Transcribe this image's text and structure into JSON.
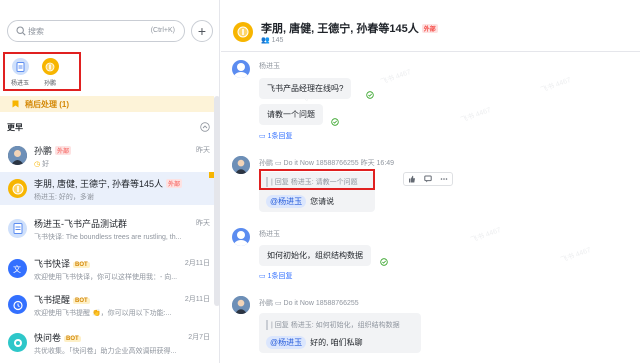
{
  "search": {
    "placeholder": "搜索",
    "shortcut": "(Ctrl+K)",
    "add_label": "+"
  },
  "pinned": [
    {
      "label": "杨进玉"
    },
    {
      "label": "孙鹏"
    }
  ],
  "later": {
    "label": "稍后处理 (1)"
  },
  "section": {
    "title": "更早"
  },
  "conversations": [
    {
      "name": "孙鹏",
      "tag": "外部",
      "preview": "好",
      "time": "昨天"
    },
    {
      "name": "李朋, 唐健, 王德宁, 孙春等145人",
      "tag": "外部",
      "preview": "杨进玉: 好的，多谢",
      "time": ""
    },
    {
      "name": "杨进玉-飞书产品测试群",
      "tag": "",
      "preview": "飞书快译: The boundless trees are rustling, th...",
      "time": "昨天"
    },
    {
      "name": "飞书快译",
      "tag": "BOT",
      "preview": "欢迎使用飞书快译，你可以这样使用我：- 向...",
      "time": "2月11日"
    },
    {
      "name": "飞书提醒",
      "tag": "BOT",
      "preview": "欢迎使用飞书提醒 👏，你可以用以下功能:...",
      "time": "2月11日"
    },
    {
      "name": "快问卷",
      "tag": "BOT",
      "preview": "共优收集。「快问卷」助力企业高效调研获得...",
      "time": "2月7日"
    }
  ],
  "chat": {
    "title": "李朋, 唐健, 王德宁, 孙春等145人",
    "tag": "外部",
    "member_count": "145",
    "messages": [
      {
        "sender": "杨进玉",
        "bubbles": [
          "飞书产品经理在线吗?",
          "请教一个问题"
        ],
        "reply": "1条回复"
      },
      {
        "sender": "孙鹏",
        "meta": "Do it Now 18588766255  昨天 16:49",
        "quote": "| 回复 杨进玉: 请教一个问题",
        "mention": "@杨进玉",
        "text": "您请说"
      },
      {
        "sender": "杨进玉",
        "bubbles": [
          "如何初始化，组织结构数据"
        ],
        "reply": "1条回复"
      },
      {
        "sender": "孙鹏",
        "meta": "Do it Now 18588766255",
        "quote": "| 回复 杨进玉: 如何初始化，组织结构数据",
        "mention": "@杨进玉",
        "text": "好的, 咱们私聊"
      }
    ]
  },
  "colors": {
    "accent": "#3370ff",
    "highlight": "#e02020",
    "later_bg": "#fdf3d8",
    "active_row": "#eaf0fb",
    "external_tag": "#f54a45"
  }
}
